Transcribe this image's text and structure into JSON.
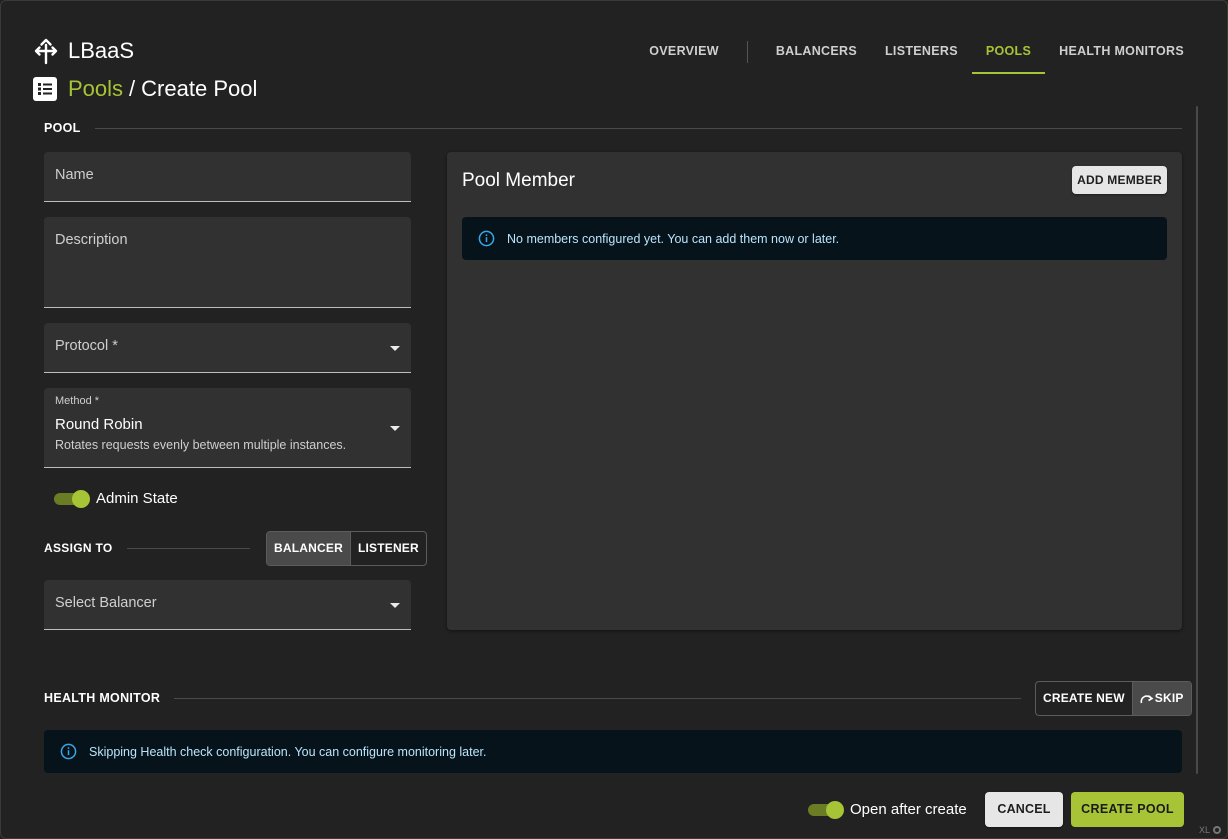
{
  "app": {
    "title": "LBaaS",
    "logo_icon": "arrows-split-icon"
  },
  "nav": {
    "tabs": [
      {
        "label": "OVERVIEW"
      },
      {
        "label": "BALANCERS"
      },
      {
        "label": "LISTENERS"
      },
      {
        "label": "POOLS",
        "active": true
      },
      {
        "label": "HEALTH MONITORS"
      }
    ]
  },
  "breadcrumb": {
    "icon": "list-icon",
    "parent": "Pools",
    "separator": "/",
    "current": "Create Pool"
  },
  "pool_section": {
    "label": "POOL"
  },
  "form": {
    "name": {
      "label": "Name",
      "value": ""
    },
    "description": {
      "label": "Description",
      "value": ""
    },
    "protocol": {
      "label": "Protocol *",
      "value": ""
    },
    "method": {
      "label": "Method *",
      "value": "Round Robin",
      "hint": "Rotates requests evenly between multiple instances."
    },
    "admin_state": {
      "label": "Admin State",
      "on": true
    },
    "assign_to": {
      "label": "ASSIGN TO",
      "options": [
        "BALANCER",
        "LISTENER"
      ],
      "selected": "BALANCER"
    },
    "balancer": {
      "label": "Select Balancer",
      "value": ""
    }
  },
  "pool_member": {
    "title": "Pool Member",
    "add_label": "ADD MEMBER",
    "empty_info": "No members configured yet. You can add them now or later."
  },
  "health_monitor": {
    "label": "HEALTH MONITOR",
    "create_label": "CREATE NEW",
    "skip_label": "SKIP",
    "selected": "SKIP",
    "info": "Skipping Health check configuration. You can configure monitoring later."
  },
  "footer": {
    "open_after_label": "Open after create",
    "open_after_on": true,
    "cancel_label": "CANCEL",
    "create_label": "CREATE POOL",
    "badge": "XL"
  },
  "colors": {
    "accent": "#a6c435",
    "background": "#222222",
    "surface": "#313131",
    "info_bg": "#07131b",
    "info_text": "#b9e4fb"
  }
}
